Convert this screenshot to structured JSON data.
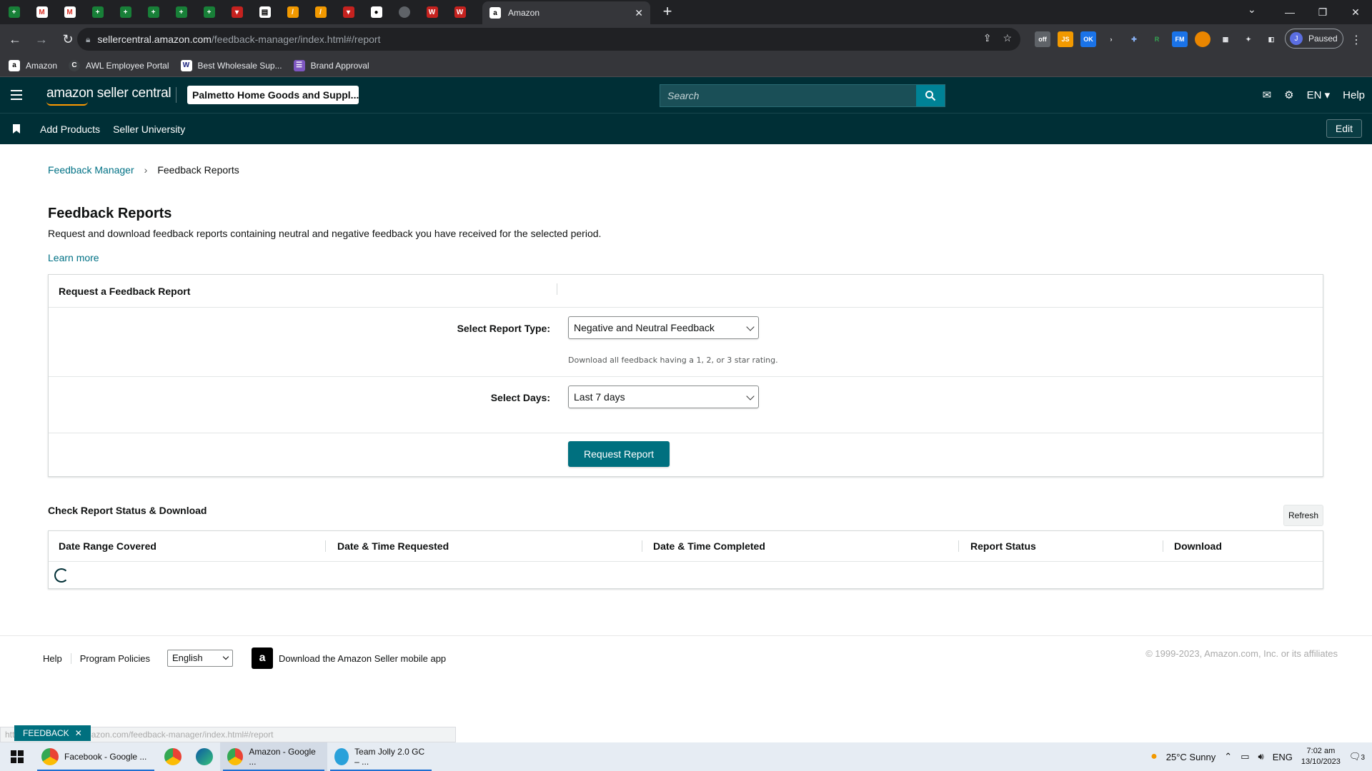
{
  "browser": {
    "active_tab_title": "Amazon",
    "url_host": "sellercentral.amazon.com",
    "url_path": "/feedback-manager/index.html#/report",
    "profile_initial": "J",
    "profile_status": "Paused",
    "bookmarks": [
      "Amazon",
      "AWL Employee Portal",
      "Best Wholesale Sup...",
      "Brand Approval"
    ]
  },
  "header": {
    "logo_text": "amazon seller central",
    "store_name": "Palmetto Home Goods and Suppl...",
    "search_placeholder": "Search",
    "language": "EN",
    "help": "Help"
  },
  "subnav": {
    "items": [
      "Add Products",
      "Seller University"
    ],
    "edit_label": "Edit"
  },
  "breadcrumb": {
    "parent": "Feedback Manager",
    "current": "Feedback Reports"
  },
  "page": {
    "title": "Feedback Reports",
    "description": "Request and download feedback reports containing neutral and negative feedback you have received for the selected period.",
    "learn_more": "Learn more"
  },
  "request_panel": {
    "title": "Request a Feedback Report",
    "report_type_label": "Select Report Type:",
    "report_type_value": "Negative and Neutral Feedback",
    "report_type_hint": "Download all feedback having a 1, 2, or 3 star rating.",
    "days_label": "Select Days:",
    "days_value": "Last 7 days",
    "request_button": "Request Report"
  },
  "status_section": {
    "title": "Check Report Status & Download",
    "refresh_label": "Refresh",
    "columns": [
      "Date Range Covered",
      "Date & Time Requested",
      "Date & Time Completed",
      "Report Status",
      "Download"
    ]
  },
  "footer": {
    "links": [
      "Help",
      "Program Policies"
    ],
    "language_value": "English",
    "app_download": "Download the Amazon Seller mobile app",
    "copyright": "© 1999-2023, Amazon.com, Inc. or its affiliates"
  },
  "overlay": {
    "status_url": "https://sellercentral.amazon.com/feedback-manager/index.html#/report",
    "feedback_tab": "FEEDBACK"
  },
  "taskbar": {
    "apps": [
      "Facebook - Google ...",
      "Amazon - Google ...",
      "Team Jolly 2.0 GC – ..."
    ],
    "weather": "25°C  Sunny",
    "language": "ENG",
    "time": "7:02 am",
    "date": "13/10/2023",
    "notifications": "3"
  },
  "colors": {
    "header_bg": "#002f36",
    "accent_teal": "#00707f",
    "link": "#007185"
  }
}
